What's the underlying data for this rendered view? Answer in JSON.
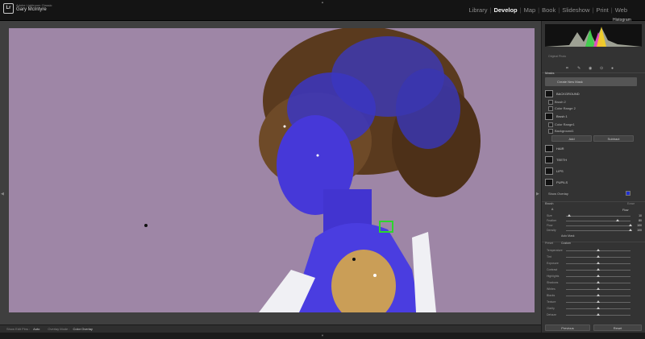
{
  "app": {
    "name": "Adobe Lightroom Classic",
    "user": "Gary McIntyre"
  },
  "modules": [
    "Library",
    "Develop",
    "Map",
    "Book",
    "Slideshow",
    "Print",
    "Web"
  ],
  "active_module": "Develop",
  "photo": {
    "bg_color": "#9e86a6",
    "overlay_color": "#4a3ae0"
  },
  "statusbar": {
    "view_label": "Show Edit Pins :",
    "view_value": "Auto",
    "overlay_label": "Overlay Mode :",
    "overlay_value": "Color Overlay"
  },
  "right_panel": {
    "histogram_title": "Histogram",
    "original_photo": "Original Photo",
    "masks_title": "Masks",
    "create_new_mask": "Create New Mask",
    "masks": [
      {
        "label": "BACKGROUND",
        "subs": [
          "Brush 2",
          "Color Range 2"
        ]
      },
      {
        "label": "Brush 1",
        "subs": [
          "Color Range1",
          "Background1"
        ]
      },
      {
        "label": "HAIR",
        "subs": []
      },
      {
        "label": "TEETH",
        "subs": []
      },
      {
        "label": "LIPS",
        "subs": []
      },
      {
        "label": "PUPILS",
        "subs": []
      }
    ],
    "add_label": "Add",
    "subtract_label": "Subtract",
    "show_overlay": "Show Overlay",
    "overlay_color": "#1f2fd0",
    "brush_title": "Brush",
    "brush_erase": "Erase",
    "brush_variant": "A",
    "brush_flow_label": "Flow",
    "brush_rows": [
      {
        "label": "Size",
        "value": 10,
        "pct": 0.05
      },
      {
        "label": "Feather",
        "value": 80,
        "pct": 0.8
      },
      {
        "label": "Flow",
        "value": 100,
        "pct": 1.0
      },
      {
        "label": "Density",
        "value": 100,
        "pct": 1.0
      }
    ],
    "auto_mask": "Auto Mask",
    "preset_label": "Preset",
    "preset_value": "Custom",
    "adjust_rows": [
      {
        "label": "Temperature",
        "value": "",
        "pct": 0.5
      },
      {
        "label": "Tint",
        "value": "",
        "pct": 0.5
      },
      {
        "label": "Exposure",
        "value": "",
        "pct": 0.5
      },
      {
        "label": "Contrast",
        "value": "",
        "pct": 0.5
      },
      {
        "label": "Highlights",
        "value": "",
        "pct": 0.5
      },
      {
        "label": "Shadows",
        "value": "",
        "pct": 0.5
      },
      {
        "label": "Whites",
        "value": "",
        "pct": 0.5
      },
      {
        "label": "Blacks",
        "value": "",
        "pct": 0.5
      },
      {
        "label": "Texture",
        "value": "",
        "pct": 0.5
      },
      {
        "label": "Clarity",
        "value": "",
        "pct": 0.5
      },
      {
        "label": "Dehaze",
        "value": "",
        "pct": 0.5
      }
    ],
    "previous_btn": "Previous",
    "reset_btn": "Reset"
  }
}
